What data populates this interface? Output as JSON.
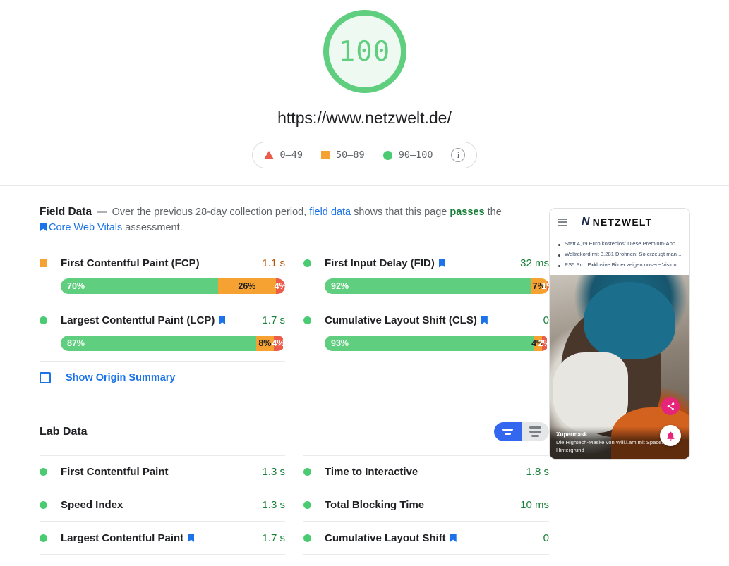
{
  "header": {
    "score": "100",
    "score_color": "#5FCE7E",
    "url": "https://www.netzwelt.de/",
    "legend": [
      {
        "icon": "triangle-icon",
        "range": "0–49"
      },
      {
        "icon": "square-icon",
        "range": "50–89"
      },
      {
        "icon": "circle-icon",
        "range": "90–100"
      }
    ],
    "info_icon": "i"
  },
  "field_data": {
    "title": "Field Data",
    "dash": "—",
    "desc_part1": "Over the previous 28-day collection period,",
    "link_field_data": "field data",
    "desc_part2": "shows that this page",
    "passes": "passes",
    "desc_part3": "the",
    "link_cwv": "Core Web Vitals",
    "desc_part4": "assessment.",
    "metrics": [
      {
        "name": "First Contentful Paint (FCP)",
        "status": "average",
        "bookmark": false,
        "value": "1.1 s",
        "value_color": "orange",
        "dist": [
          {
            "pct": 70,
            "label": "70%",
            "band": "good"
          },
          {
            "pct": 26,
            "label": "26%",
            "band": "avg"
          },
          {
            "pct": 4,
            "label": "4%",
            "band": "poor"
          }
        ]
      },
      {
        "name": "First Input Delay (FID)",
        "status": "good",
        "bookmark": true,
        "value": "32 ms",
        "value_color": "green",
        "dist": [
          {
            "pct": 92,
            "label": "92%",
            "band": "good"
          },
          {
            "pct": 7,
            "label": "7%",
            "band": "avg"
          },
          {
            "pct": 1,
            "label": "1%",
            "band": "poor"
          }
        ]
      },
      {
        "name": "Largest Contentful Paint (LCP)",
        "status": "good",
        "bookmark": true,
        "value": "1.7 s",
        "value_color": "green",
        "dist": [
          {
            "pct": 87,
            "label": "87%",
            "band": "good"
          },
          {
            "pct": 8,
            "label": "8%",
            "band": "avg"
          },
          {
            "pct": 4,
            "label": "4%",
            "band": "poor"
          }
        ]
      },
      {
        "name": "Cumulative Layout Shift (CLS)",
        "status": "good",
        "bookmark": true,
        "value": "0",
        "value_color": "green",
        "dist": [
          {
            "pct": 93,
            "label": "93%",
            "band": "good"
          },
          {
            "pct": 4,
            "label": "4%",
            "band": "avg"
          },
          {
            "pct": 2,
            "label": "2%",
            "band": "poor"
          }
        ]
      }
    ],
    "origin_summary_label": "Show Origin Summary",
    "origin_summary_checked": false
  },
  "lab_data": {
    "title": "Lab Data",
    "view_toggle": {
      "active": "compact-view",
      "options": [
        {
          "name": "compact-view",
          "icon": "two-line-icon"
        },
        {
          "name": "detail-view",
          "icon": "three-line-icon"
        }
      ]
    },
    "metrics": [
      {
        "name": "First Contentful Paint",
        "value": "1.3 s",
        "status": "good",
        "bookmark": false
      },
      {
        "name": "Time to Interactive",
        "value": "1.8 s",
        "status": "good",
        "bookmark": false
      },
      {
        "name": "Speed Index",
        "value": "1.3 s",
        "status": "good",
        "bookmark": false
      },
      {
        "name": "Total Blocking Time",
        "value": "10 ms",
        "status": "good",
        "bookmark": false
      },
      {
        "name": "Largest Contentful Paint",
        "value": "1.7 s",
        "status": "good",
        "bookmark": true
      },
      {
        "name": "Cumulative Layout Shift",
        "value": "0",
        "status": "good",
        "bookmark": true
      }
    ]
  },
  "screenshot": {
    "site_name": "NETZWELT",
    "menu_icon": "hamburger-icon",
    "headlines": [
      "Statt 4,19 Euro kostenlos: Diese Premium-App ...",
      "Weltrekord mit 3.281 Drohnen: So erzeugt man ...",
      "PS5 Pro: Exklusive Bilder zeigen unsere Vision z..."
    ],
    "caption_title": "Xupermask",
    "caption_sub": "Die Hightech-Maske von Will.i.am mit SpaceX-Hintergrund",
    "share_icon": "share-icon",
    "bell_icon": "bell-icon"
  }
}
